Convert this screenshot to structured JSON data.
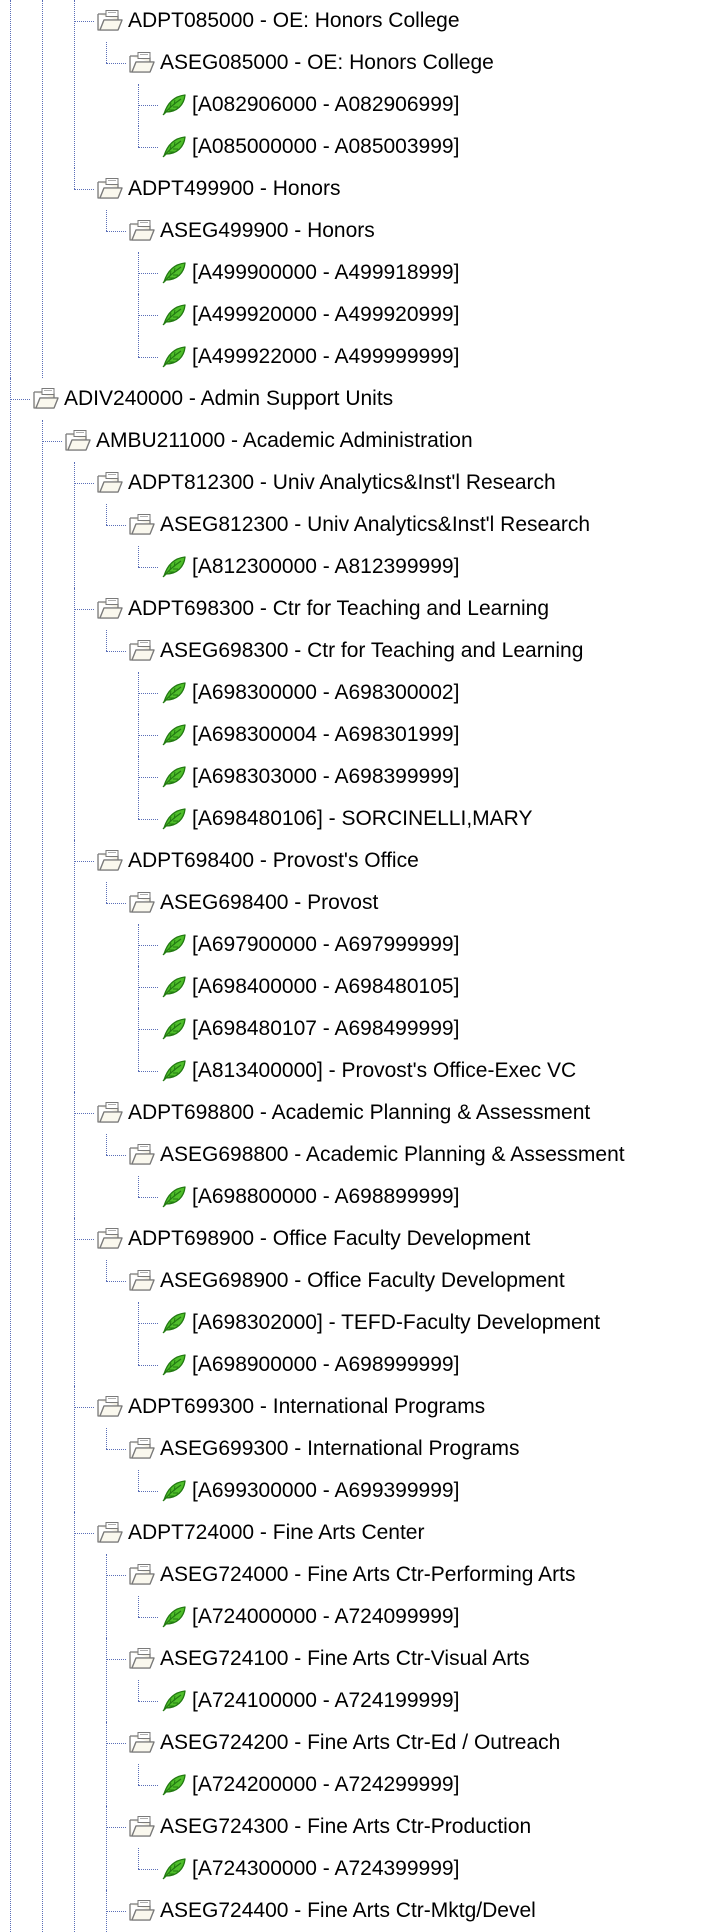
{
  "tree": {
    "nodes": [
      {
        "level": 2,
        "icon": "folder-open-icon",
        "label": "ADPT085000 - OE: Honors College",
        "last": false
      },
      {
        "level": 3,
        "icon": "folder-open-icon",
        "label": "ASEG085000 - OE: Honors College",
        "last": true
      },
      {
        "level": 4,
        "icon": "leaf-icon",
        "label": "[A082906000 - A082906999]",
        "last": false
      },
      {
        "level": 4,
        "icon": "leaf-icon",
        "label": "[A085000000 - A085003999]",
        "last": true
      },
      {
        "level": 2,
        "icon": "folder-open-icon",
        "label": "ADPT499900 - Honors",
        "last": true
      },
      {
        "level": 3,
        "icon": "folder-open-icon",
        "label": "ASEG499900 - Honors",
        "last": true
      },
      {
        "level": 4,
        "icon": "leaf-icon",
        "label": "[A499900000 - A499918999]",
        "last": false
      },
      {
        "level": 4,
        "icon": "leaf-icon",
        "label": "[A499920000 - A499920999]",
        "last": false
      },
      {
        "level": 4,
        "icon": "leaf-icon",
        "label": "[A499922000 - A499999999]",
        "last": true
      },
      {
        "level": 0,
        "icon": "folder-open-icon",
        "label": "ADIV240000 - Admin Support Units",
        "last": false
      },
      {
        "level": 1,
        "icon": "folder-open-icon",
        "label": "AMBU211000 - Academic Administration",
        "last": false
      },
      {
        "level": 2,
        "icon": "folder-open-icon",
        "label": "ADPT812300 - Univ Analytics&Inst'l Research",
        "last": false
      },
      {
        "level": 3,
        "icon": "folder-open-icon",
        "label": "ASEG812300 - Univ Analytics&Inst'l Research",
        "last": true
      },
      {
        "level": 4,
        "icon": "leaf-icon",
        "label": "[A812300000 - A812399999]",
        "last": true
      },
      {
        "level": 2,
        "icon": "folder-open-icon",
        "label": "ADPT698300 - Ctr for Teaching and Learning",
        "last": false
      },
      {
        "level": 3,
        "icon": "folder-open-icon",
        "label": "ASEG698300 - Ctr for Teaching and Learning",
        "last": true
      },
      {
        "level": 4,
        "icon": "leaf-icon",
        "label": "[A698300000 - A698300002]",
        "last": false
      },
      {
        "level": 4,
        "icon": "leaf-icon",
        "label": "[A698300004 - A698301999]",
        "last": false
      },
      {
        "level": 4,
        "icon": "leaf-icon",
        "label": "[A698303000 - A698399999]",
        "last": false
      },
      {
        "level": 4,
        "icon": "leaf-icon",
        "label": "[A698480106] - SORCINELLI,MARY",
        "last": true
      },
      {
        "level": 2,
        "icon": "folder-open-icon",
        "label": "ADPT698400 - Provost's Office",
        "last": false
      },
      {
        "level": 3,
        "icon": "folder-open-icon",
        "label": "ASEG698400 - Provost",
        "last": true
      },
      {
        "level": 4,
        "icon": "leaf-icon",
        "label": "[A697900000 - A697999999]",
        "last": false
      },
      {
        "level": 4,
        "icon": "leaf-icon",
        "label": "[A698400000 - A698480105]",
        "last": false
      },
      {
        "level": 4,
        "icon": "leaf-icon",
        "label": "[A698480107 - A698499999]",
        "last": false
      },
      {
        "level": 4,
        "icon": "leaf-icon",
        "label": "[A813400000] - Provost's Office-Exec VC",
        "last": true
      },
      {
        "level": 2,
        "icon": "folder-open-icon",
        "label": "ADPT698800 - Academic Planning & Assessment",
        "last": false
      },
      {
        "level": 3,
        "icon": "folder-open-icon",
        "label": "ASEG698800 - Academic Planning & Assessment",
        "last": true
      },
      {
        "level": 4,
        "icon": "leaf-icon",
        "label": "[A698800000 - A698899999]",
        "last": true
      },
      {
        "level": 2,
        "icon": "folder-open-icon",
        "label": "ADPT698900 - Office Faculty Development",
        "last": false
      },
      {
        "level": 3,
        "icon": "folder-open-icon",
        "label": "ASEG698900 - Office Faculty Development",
        "last": true
      },
      {
        "level": 4,
        "icon": "leaf-icon",
        "label": "[A698302000] - TEFD-Faculty Development",
        "last": false
      },
      {
        "level": 4,
        "icon": "leaf-icon",
        "label": "[A698900000 - A698999999]",
        "last": true
      },
      {
        "level": 2,
        "icon": "folder-open-icon",
        "label": "ADPT699300 - International Programs",
        "last": false
      },
      {
        "level": 3,
        "icon": "folder-open-icon",
        "label": "ASEG699300 - International Programs",
        "last": true
      },
      {
        "level": 4,
        "icon": "leaf-icon",
        "label": "[A699300000 - A699399999]",
        "last": true
      },
      {
        "level": 2,
        "icon": "folder-open-icon",
        "label": "ADPT724000 - Fine Arts Center",
        "last": false
      },
      {
        "level": 3,
        "icon": "folder-open-icon",
        "label": "ASEG724000 - Fine Arts Ctr-Performing Arts",
        "last": false
      },
      {
        "level": 4,
        "icon": "leaf-icon",
        "label": "[A724000000 - A724099999]",
        "last": true
      },
      {
        "level": 3,
        "icon": "folder-open-icon",
        "label": "ASEG724100 - Fine Arts Ctr-Visual Arts",
        "last": false
      },
      {
        "level": 4,
        "icon": "leaf-icon",
        "label": "[A724100000 - A724199999]",
        "last": true
      },
      {
        "level": 3,
        "icon": "folder-open-icon",
        "label": "ASEG724200 - Fine Arts Ctr-Ed / Outreach",
        "last": false
      },
      {
        "level": 4,
        "icon": "leaf-icon",
        "label": "[A724200000 - A724299999]",
        "last": true
      },
      {
        "level": 3,
        "icon": "folder-open-icon",
        "label": "ASEG724300 - Fine Arts Ctr-Production",
        "last": false
      },
      {
        "level": 4,
        "icon": "leaf-icon",
        "label": "[A724300000 - A724399999]",
        "last": true
      },
      {
        "level": 3,
        "icon": "folder-open-icon",
        "label": "ASEG724400 - Fine Arts Ctr-Mktg/Devel",
        "last": false
      }
    ]
  },
  "colors": {
    "connector": "#5b6fb8",
    "folder_fill": "#f3f0e4",
    "folder_stroke": "#7a7a7a",
    "leaf_fill": "#4fbf2a",
    "leaf_stroke": "#237a12"
  }
}
